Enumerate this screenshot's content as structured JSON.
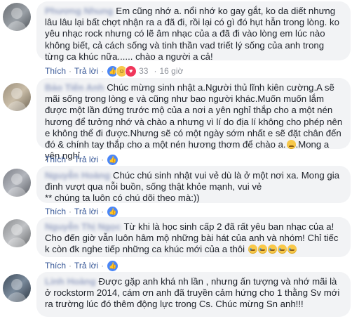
{
  "actions": {
    "like": "Thích",
    "reply": "Trả lời"
  },
  "comments": [
    {
      "author": "Phương Nhung",
      "text": "Em cũng nhớ a. nổi nhớ ko gay gắt, ko da diết nhưng lâu lâu lại bất chợt nhận ra a đã đi, rồi lại có gì đó hụt hẫn trong lòng. ko yêu nhạc rock nhưng có lẽ âm nhạc của a đã đi vào lòng em lúc nào không biết, cả cách sống và tinh thần vad triết lý sống của anh trong từng ca khúc nữa...... chào a người a cả!",
      "reactions": [
        "like-icon",
        "haha-icon",
        "love-icon"
      ],
      "count": "33",
      "time": "16 giờ"
    },
    {
      "author": "Bảo Tiến Anh",
      "text": "Chúc mừng sinh nhật a.Người thủ lĩnh kiên cường.A sẽ mãi sống trong lòng e và cũng như bao người khác.Muốn muốn lắm được một lần đứng trước mộ của a nơi a yên nghỉ thắp cho a một nén hương để tưởng nhớ và chào a nhưng vì lí do địa lí không cho phép nên e không thể đi được.Nhưng sẽ có một ngày sớm nhất e sẽ đặt chân đến đó & chính tay thắp cho a một nén hương thơm để chào a.",
      "text_after_emoji": ".Mong a yên nghỉ",
      "reactions": [
        "like-icon"
      ],
      "count": "",
      "time": ""
    },
    {
      "author": "Nguyễn Hoàng",
      "text": "Chúc chú sinh nhật vui vẻ dù là ở một nơi xa. Mong gia đình vượt qua nỗi buồn, sống thật khỏe mạnh, vui vẻ",
      "text_line2": "** chúng ta luôn có chú dõi theo mà:))",
      "reactions": [
        "like-icon"
      ],
      "count": "",
      "time": ""
    },
    {
      "author": "Nguyễn Thị Ngọc",
      "text": "Từ khi là học sinh cấp 2 đã rất yêu ban nhạc của a! Cho đến giờ vẫn luôn hâm mộ những bài hát của anh và nhóm! Chỉ tiếc k còn đk nghe tiếp những ca khúc mới của a thôi",
      "reactions": [
        "like-icon"
      ],
      "count": "",
      "time": ""
    },
    {
      "author": "Linh Hoàng",
      "text": "Được gặp anh khá nh lần , nhưng ấn tượng và nhớ mãi là ở rockstorm 2014, cám ơn anh đã truyền cảm hứng cho 1 thằng Sv mới ra trường lúc đó thêm động lực trong Cs. Chúc mừng Sn anh!!!",
      "reactions": [],
      "count": "",
      "time": ""
    }
  ]
}
